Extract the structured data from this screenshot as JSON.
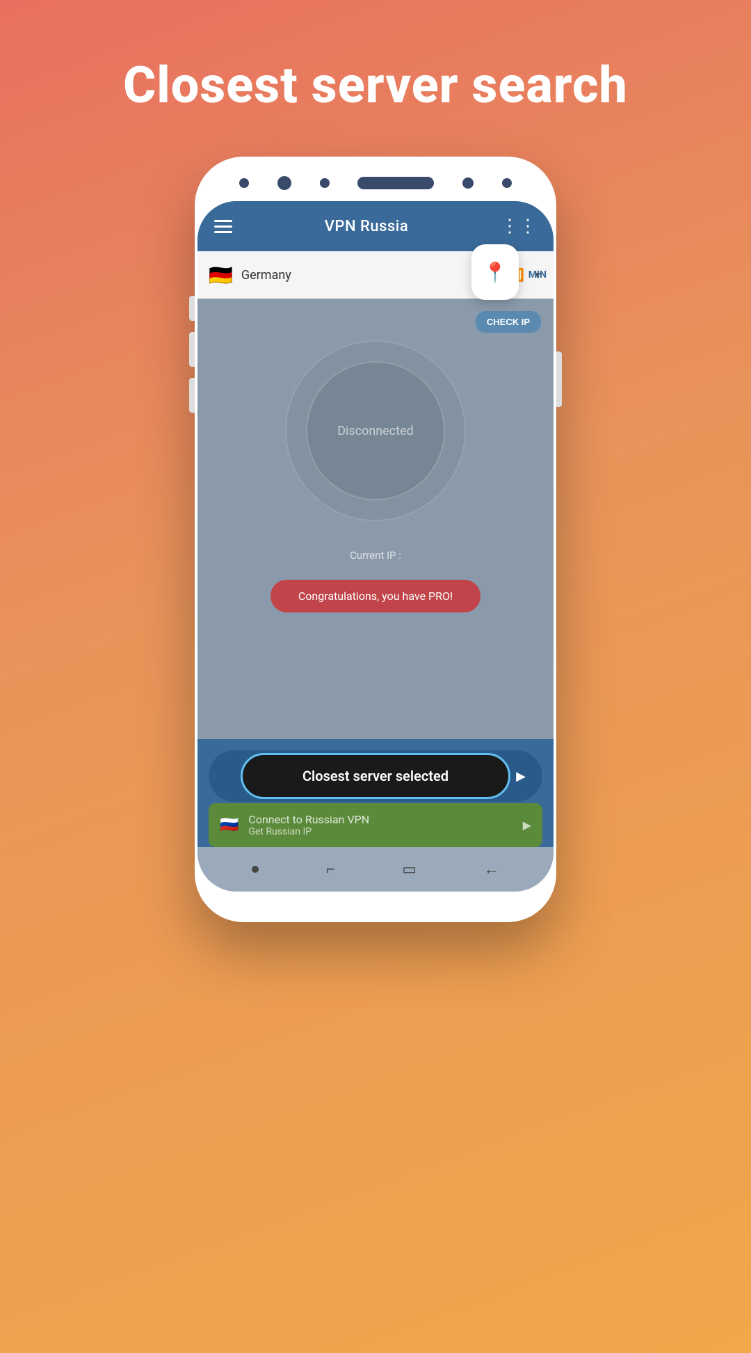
{
  "page": {
    "title": "Closest server search",
    "background_gradient_start": "#e87060",
    "background_gradient_end": "#f0a84a"
  },
  "app": {
    "header": {
      "title": "VPN Russia",
      "menu_icon": "menu",
      "share_icon": "share"
    },
    "server_selector": {
      "country": "Germany",
      "flag_emoji": "🇩🇪",
      "signal_icon": "signal",
      "dropdown_icon": "▼",
      "location_pin_label": "MIN"
    },
    "main": {
      "check_ip_button": "CHECK IP",
      "status_text": "Disconnected",
      "current_ip_label": "Current IP :",
      "pro_banner_text": "Congratulations, you have PRO!"
    },
    "bottom": {
      "closest_server_text": "Closest server selected",
      "closest_server_arrow": "▶",
      "russian_vpn_title": "Connect to Russian VPN",
      "russian_vpn_subtitle": "Get Russian IP",
      "russian_flag_emoji": "🇷🇺",
      "russian_arrow": "▶"
    },
    "nav": {
      "icons": [
        "●",
        "⌐",
        "□",
        "←"
      ]
    }
  }
}
